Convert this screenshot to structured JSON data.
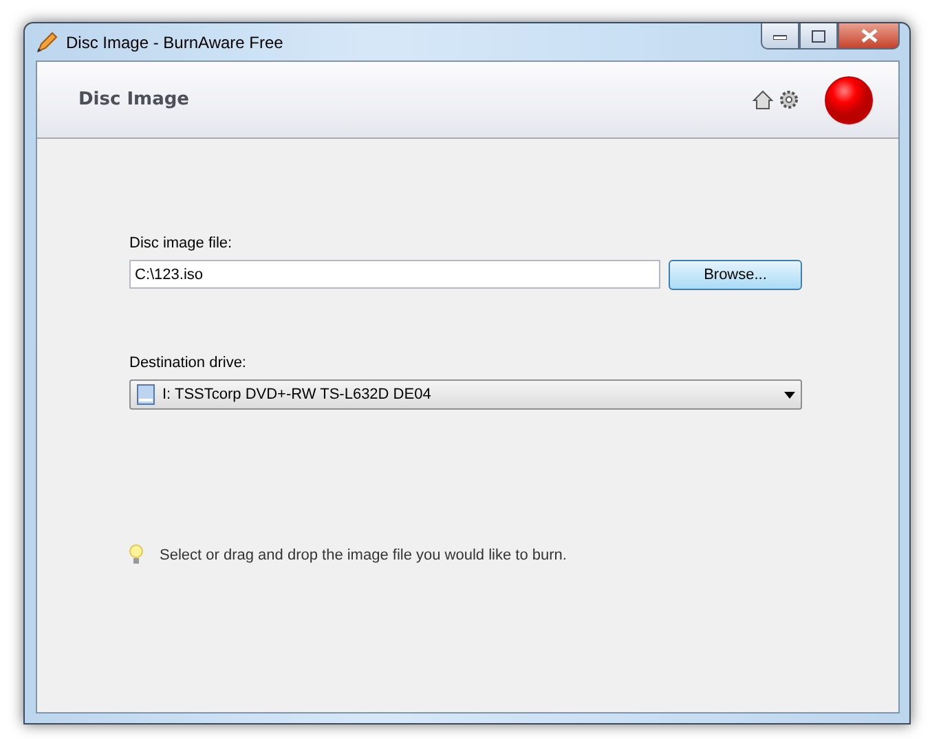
{
  "window": {
    "title": "Disc Image - BurnAware Free"
  },
  "header": {
    "title": "Disc Image"
  },
  "image_file": {
    "label": "Disc image file:",
    "value": "C:\\123.iso",
    "browse_button": "Browse..."
  },
  "destination": {
    "label": "Destination drive:",
    "value": "I: TSSTcorp DVD+-RW TS-L632D DE04"
  },
  "hint": "Select or drag and drop the image file you would like to burn."
}
